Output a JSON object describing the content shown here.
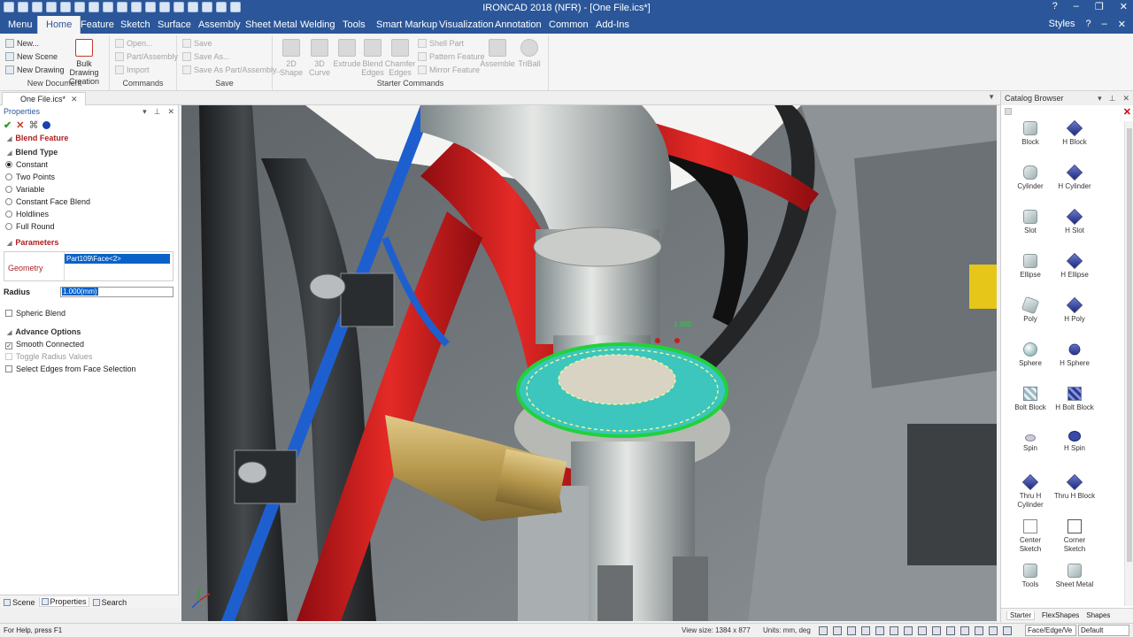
{
  "app": {
    "title": "IRONCAD 2018 (NFR) - [One File.ics*]",
    "window_controls": [
      "?",
      "–",
      "❐",
      "✕"
    ],
    "accent": "#2b579a"
  },
  "ribbon_tabs": [
    "Menu",
    "Home",
    "Feature",
    "Sketch",
    "Surface",
    "Assembly",
    "Sheet Metal",
    "Welding",
    "Tools",
    "Smart Markup",
    "Visualization",
    "Annotation",
    "Common",
    "Add-Ins"
  ],
  "ribbon_tabs_active": "Home",
  "ribbon_right": {
    "styles": "Styles",
    "help": "?",
    "min": "–",
    "close": "✕"
  },
  "ribbon": {
    "new_document": {
      "label": "New Document",
      "new": "New...",
      "new_scene": "New Scene",
      "new_drawing": "New Drawing",
      "bulk_drawing": "Bulk Drawing\nCreation"
    },
    "commands": {
      "label": "Commands",
      "open": "Open...",
      "part_assembly": "Part/Assembly",
      "import": "Import"
    },
    "save": {
      "label": "Save",
      "save": "Save",
      "save_as": "Save As...",
      "save_as_part": "Save As Part/Assembly..."
    },
    "starter": {
      "label": "Starter Commands",
      "shape_2d": "2D\nShape",
      "curve_3d": "3D\nCurve",
      "extrude": "Extrude",
      "blend_edges": "Blend\nEdges",
      "chamfer_edges": "Chamfer\nEdges",
      "shell_part": "Shell Part",
      "pattern_feature": "Pattern Feature",
      "mirror_feature": "Mirror Feature",
      "assemble": "Assemble",
      "triball": "TriBall"
    }
  },
  "document_tab": {
    "label": "One File.ics*",
    "close": "✕"
  },
  "properties": {
    "title": "Properties",
    "feature_title": "Blend Feature",
    "blend_type_label": "Blend Type",
    "blend_types": [
      "Constant",
      "Two Points",
      "Variable",
      "Constant Face Blend",
      "Holdlines",
      "Full Round"
    ],
    "blend_type_selected": "Constant",
    "parameters_label": "Parameters",
    "geometry_label": "Geometry",
    "geometry_value": "Part109\\Face<2>",
    "radius_label": "Radius",
    "radius_value": "1.000(mm)",
    "spheric_blend": "Spheric Blend",
    "advance_label": "Advance Options",
    "smooth_connected": "Smooth Connected",
    "toggle_radius": "Toggle Radius Values",
    "select_edges": "Select Edges from Face Selection",
    "bottom_tabs": [
      "Scene",
      "Properties",
      "Search"
    ]
  },
  "catalog": {
    "title": "Catalog Browser",
    "items": [
      {
        "label": "Block",
        "icon": "block-icon"
      },
      {
        "label": "H Block",
        "icon": "h-block-icon"
      },
      {
        "label": "Cylinder",
        "icon": "cylinder-icon"
      },
      {
        "label": "H Cylinder",
        "icon": "h-cylinder-icon"
      },
      {
        "label": "Slot",
        "icon": "slot-icon"
      },
      {
        "label": "H Slot",
        "icon": "h-slot-icon"
      },
      {
        "label": "Ellipse",
        "icon": "ellipse-icon"
      },
      {
        "label": "H Ellipse",
        "icon": "h-ellipse-icon"
      },
      {
        "label": "Poly",
        "icon": "poly-icon"
      },
      {
        "label": "H Poly",
        "icon": "h-poly-icon"
      },
      {
        "label": "Sphere",
        "icon": "sphere-icon"
      },
      {
        "label": "H Sphere",
        "icon": "h-sphere-icon"
      },
      {
        "label": "Bolt Block",
        "icon": "bolt-block-icon"
      },
      {
        "label": "H Bolt Block",
        "icon": "h-bolt-block-icon"
      },
      {
        "label": "Spin",
        "icon": "spin-icon"
      },
      {
        "label": "H Spin",
        "icon": "h-spin-icon"
      },
      {
        "label": "Thru H\nCylinder",
        "icon": "thru-h-cylinder-icon"
      },
      {
        "label": "Thru H Block",
        "icon": "thru-h-block-icon"
      },
      {
        "label": "Center\nSketch",
        "icon": "center-sketch-icon"
      },
      {
        "label": "Corner\nSketch",
        "icon": "corner-sketch-icon"
      },
      {
        "label": "Tools",
        "icon": "tools-icon"
      },
      {
        "label": "Sheet Metal",
        "icon": "sheet-metal-icon"
      }
    ],
    "tabs": [
      "Starter",
      "FlexShapes",
      "Shapes"
    ]
  },
  "viewport": {
    "dimension_readout": "1.000"
  },
  "status": {
    "help": "For Help, press F1",
    "view_size": "View size: 1384 x 877",
    "units": "Units: mm, deg",
    "selection_filter": "Face/Edge/Ve",
    "style": "Default"
  }
}
